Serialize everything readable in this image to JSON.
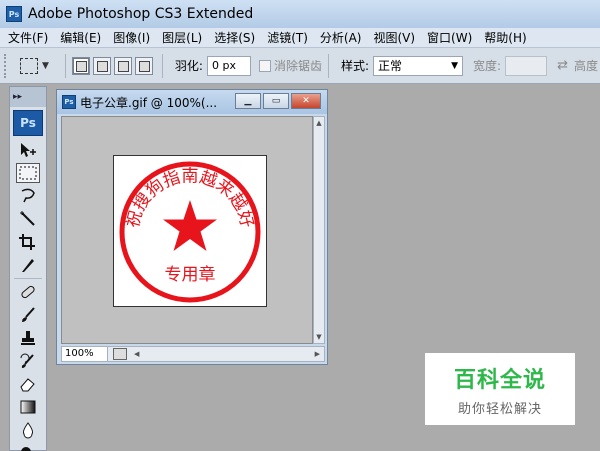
{
  "app": {
    "title": "Adobe Photoshop CS3 Extended",
    "logo": "Ps"
  },
  "menu": [
    "文件(F)",
    "编辑(E)",
    "图像(I)",
    "图层(L)",
    "选择(S)",
    "滤镜(T)",
    "分析(A)",
    "视图(V)",
    "窗口(W)",
    "帮助(H)"
  ],
  "options": {
    "feather_label": "羽化:",
    "feather_value": "0 px",
    "antialias_label": "消除锯齿",
    "style_label": "样式:",
    "style_value": "正常",
    "width_label": "宽度:",
    "height_label": "高度"
  },
  "toolbox": {
    "logo": "Ps",
    "tools": [
      "move-tool-icon",
      "rectangular-marquee-tool-icon",
      "lasso-tool-icon",
      "magic-wand-tool-icon",
      "crop-tool-icon",
      "slice-tool-icon",
      "healing-brush-tool-icon",
      "brush-tool-icon",
      "clone-stamp-tool-icon",
      "history-brush-tool-icon",
      "eraser-tool-icon",
      "gradient-tool-icon",
      "blur-tool-icon",
      "dodge-tool-icon"
    ]
  },
  "document": {
    "title": "电子公章.gif @ 100%(...",
    "zoom": "100%",
    "stamp": {
      "arc_text": "祝搜狗指南越来越好",
      "bottom_text": "专用章",
      "color": "#e8141c"
    }
  },
  "watermark": {
    "title": "百科全说",
    "subtitle": "助你轻松解决"
  },
  "colors": {
    "stamp_red": "#e8141c",
    "watermark_green": "#2fb84a",
    "workspace_gray": "#ababab"
  }
}
